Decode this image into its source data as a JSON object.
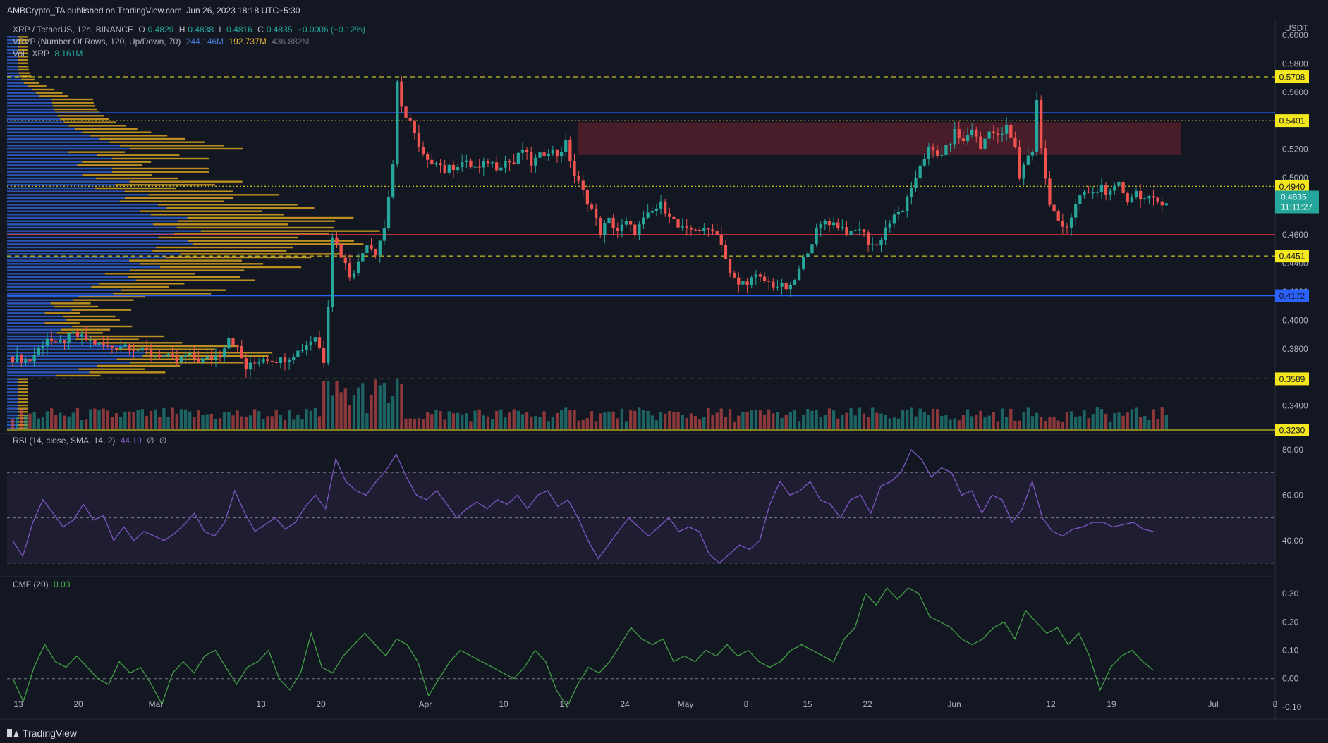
{
  "header": {
    "publisher": "AMBCrypto_TA published on TradingView.com, Jun 26, 2023 18:18 UTC+5:30"
  },
  "legend": {
    "symbol": "XRP / TetherUS, 12h, BINANCE",
    "o_label": "O",
    "o": "0.4829",
    "h_label": "H",
    "h": "0.4838",
    "l_label": "L",
    "l": "0.4816",
    "c_label": "C",
    "c": "0.4835",
    "change": "+0.0006 (+0.12%)",
    "vrvp_label": "VRVP (Number Of Rows, 120, Up/Down, 70)",
    "vrvp_up": "244.146M",
    "vrvp_down": "192.737M",
    "vrvp_total": "436.882M",
    "vol_label": "Vol · XRP",
    "vol_value": "8.161M",
    "rsi_label": "RSI (14, close, SMA, 14, 2)",
    "rsi_value": "44.19",
    "rsi_na1": "∅",
    "rsi_na2": "∅",
    "cmf_label": "CMF (20)",
    "cmf_value": "0.03"
  },
  "price_axis": {
    "currency": "USDT",
    "current_price": "0.4835",
    "countdown": "11:11:27"
  },
  "brand": "TradingView",
  "colors": {
    "background": "#131722",
    "up": "#26a69a",
    "down": "#ef5350",
    "level_yellow": "#f5e71e",
    "level_blue": "#2962ff",
    "level_red": "#f23645",
    "zone": "#5c1f2c",
    "vp_up": "#2f5fd0",
    "vp_down": "#d9a520",
    "rsi": "#7e57c2",
    "cmf": "#43a047"
  },
  "chart_data": [
    {
      "type": "candlestick",
      "title": "XRP / TetherUS, 12h, BINANCE",
      "ylim": [
        0.323,
        0.6
      ],
      "y_ticks": [
        "0.6000",
        "0.5800",
        "0.5600",
        "0.5200",
        "0.5000",
        "0.4600",
        "0.4400",
        "0.4200",
        "0.4000",
        "0.3800",
        "0.3600",
        "0.3400"
      ],
      "y_tick_values": [
        0.6,
        0.58,
        0.56,
        0.52,
        0.5,
        0.46,
        0.44,
        0.42,
        0.4,
        0.38,
        0.36,
        0.34
      ],
      "x_ticks": [
        "13",
        "20",
        "Mar",
        "13",
        "20",
        "Apr",
        "10",
        "17",
        "24",
        "May",
        "8",
        "15",
        "22",
        "Jun",
        "12",
        "19",
        "Jul",
        "8"
      ],
      "horizontal_levels": [
        {
          "label": "0.5708",
          "value": 0.5708,
          "style": "dashed",
          "color": "yellow"
        },
        {
          "label": "0.5401",
          "value": 0.5401,
          "style": "dotted",
          "color": "yellow"
        },
        {
          "label": "0.4940",
          "value": 0.494,
          "style": "dotted",
          "color": "yellow"
        },
        {
          "label": "0.4451",
          "value": 0.4451,
          "style": "dashed",
          "color": "yellow"
        },
        {
          "label": "0.4172",
          "value": 0.4172,
          "style": "solid",
          "color": "blue"
        },
        {
          "label": "0.3589",
          "value": 0.3589,
          "style": "dashed",
          "color": "yellow"
        },
        {
          "label": "0.3230",
          "value": 0.323,
          "style": "solid",
          "color": "yellow"
        },
        {
          "value": 0.5455,
          "style": "solid",
          "color": "blue"
        },
        {
          "value": 0.46,
          "style": "solid",
          "color": "red"
        }
      ],
      "supply_zone": {
        "low": 0.516,
        "high": 0.539
      },
      "current_price": 0.4835,
      "price_path": [
        [
          0,
          0.374
        ],
        [
          4,
          0.372
        ],
        [
          8,
          0.388
        ],
        [
          10,
          0.382
        ],
        [
          14,
          0.39
        ],
        [
          18,
          0.385
        ],
        [
          22,
          0.381
        ],
        [
          26,
          0.383
        ],
        [
          30,
          0.378
        ],
        [
          34,
          0.376
        ],
        [
          38,
          0.371
        ],
        [
          40,
          0.375
        ],
        [
          44,
          0.372
        ],
        [
          48,
          0.376
        ],
        [
          50,
          0.389
        ],
        [
          52,
          0.38
        ],
        [
          54,
          0.366
        ],
        [
          56,
          0.37
        ],
        [
          58,
          0.374
        ],
        [
          62,
          0.372
        ],
        [
          66,
          0.378
        ],
        [
          68,
          0.383
        ],
        [
          70,
          0.389
        ],
        [
          72,
          0.372
        ],
        [
          73,
          0.412
        ],
        [
          74,
          0.46
        ],
        [
          76,
          0.446
        ],
        [
          78,
          0.432
        ],
        [
          80,
          0.44
        ],
        [
          82,
          0.455
        ],
        [
          84,
          0.448
        ],
        [
          86,
          0.465
        ],
        [
          88,
          0.51
        ],
        [
          89,
          0.565
        ],
        [
          90,
          0.548
        ],
        [
          92,
          0.54
        ],
        [
          94,
          0.52
        ],
        [
          96,
          0.51
        ],
        [
          98,
          0.513
        ],
        [
          100,
          0.505
        ],
        [
          104,
          0.511
        ],
        [
          108,
          0.506
        ],
        [
          110,
          0.512
        ],
        [
          112,
          0.508
        ],
        [
          114,
          0.512
        ],
        [
          116,
          0.51
        ],
        [
          118,
          0.52
        ],
        [
          120,
          0.51
        ],
        [
          124,
          0.52
        ],
        [
          126,
          0.516
        ],
        [
          128,
          0.524
        ],
        [
          130,
          0.502
        ],
        [
          132,
          0.49
        ],
        [
          134,
          0.478
        ],
        [
          136,
          0.462
        ],
        [
          138,
          0.47
        ],
        [
          140,
          0.463
        ],
        [
          142,
          0.468
        ],
        [
          144,
          0.462
        ],
        [
          146,
          0.47
        ],
        [
          148,
          0.476
        ],
        [
          150,
          0.481
        ],
        [
          152,
          0.475
        ],
        [
          154,
          0.465
        ],
        [
          156,
          0.462
        ],
        [
          158,
          0.465
        ],
        [
          160,
          0.462
        ],
        [
          162,
          0.465
        ],
        [
          164,
          0.455
        ],
        [
          166,
          0.432
        ],
        [
          168,
          0.425
        ],
        [
          172,
          0.43
        ],
        [
          176,
          0.425
        ],
        [
          180,
          0.422
        ],
        [
          182,
          0.435
        ],
        [
          184,
          0.45
        ],
        [
          186,
          0.462
        ],
        [
          188,
          0.47
        ],
        [
          190,
          0.468
        ],
        [
          192,
          0.465
        ],
        [
          194,
          0.46
        ],
        [
          196,
          0.465
        ],
        [
          198,
          0.455
        ],
        [
          200,
          0.452
        ],
        [
          202,
          0.465
        ],
        [
          204,
          0.472
        ],
        [
          206,
          0.478
        ],
        [
          208,
          0.49
        ],
        [
          210,
          0.51
        ],
        [
          212,
          0.52
        ],
        [
          214,
          0.515
        ],
        [
          216,
          0.52
        ],
        [
          218,
          0.532
        ],
        [
          220,
          0.525
        ],
        [
          222,
          0.535
        ],
        [
          224,
          0.52
        ],
        [
          226,
          0.535
        ],
        [
          228,
          0.528
        ],
        [
          230,
          0.535
        ],
        [
          232,
          0.52
        ],
        [
          233,
          0.5
        ],
        [
          234,
          0.51
        ],
        [
          236,
          0.52
        ],
        [
          237,
          0.555
        ],
        [
          238,
          0.52
        ],
        [
          240,
          0.48
        ],
        [
          242,
          0.47
        ],
        [
          244,
          0.466
        ],
        [
          246,
          0.48
        ],
        [
          248,
          0.49
        ],
        [
          250,
          0.488
        ],
        [
          252,
          0.494
        ],
        [
          254,
          0.488
        ],
        [
          256,
          0.495
        ],
        [
          258,
          0.485
        ],
        [
          260,
          0.49
        ],
        [
          262,
          0.485
        ],
        [
          264,
          0.4835
        ]
      ],
      "volume_label": "Vol · XRP",
      "volume_last": "8.161M",
      "volume_profile": {
        "label": "VRVP (Number Of Rows, 120, Up/Down, 70)",
        "up": "244.146M",
        "down": "192.737M",
        "total": "436.882M",
        "poc": 0.4605
      }
    },
    {
      "type": "line",
      "title": "RSI (14, close, SMA, 14, 2)",
      "ylim": [
        25,
        85
      ],
      "y_ticks": [
        "80.00",
        "60.00",
        "40.00"
      ],
      "y_tick_values": [
        80,
        60,
        40
      ],
      "bands": [
        70,
        50,
        30
      ],
      "last_value": 44.19,
      "series": [
        {
          "values": [
            40,
            33,
            48,
            58,
            52,
            46,
            49,
            56,
            49,
            51,
            40,
            46,
            40,
            44,
            42,
            40,
            43,
            47,
            52,
            44,
            42,
            48,
            62,
            52,
            44,
            47,
            50,
            45,
            48,
            55,
            60,
            54,
            76,
            66,
            62,
            60,
            66,
            71,
            78,
            68,
            60,
            58,
            62,
            56,
            50,
            54,
            57,
            54,
            58,
            56,
            60,
            54,
            60,
            62,
            55,
            58,
            50,
            40,
            32,
            38,
            44,
            50,
            46,
            42,
            46,
            50,
            44,
            46,
            44,
            34,
            30,
            34,
            38,
            36,
            40,
            56,
            66,
            60,
            62,
            66,
            58,
            56,
            50,
            58,
            60,
            52,
            64,
            66,
            70,
            80,
            76,
            68,
            72,
            70,
            60,
            62,
            52,
            60,
            58,
            48,
            54,
            66,
            50,
            44,
            42,
            45,
            46,
            48,
            48,
            46,
            47,
            48,
            45,
            44
          ]
        }
      ]
    },
    {
      "type": "line",
      "title": "CMF (20)",
      "ylim": [
        -0.13,
        0.34
      ],
      "y_ticks": [
        "0.30",
        "0.20",
        "0.10",
        "0.00",
        "-0.10"
      ],
      "y_tick_values": [
        0.3,
        0.2,
        0.1,
        0.0,
        -0.1
      ],
      "last_value": 0.03,
      "series": [
        {
          "values": [
            0.0,
            -0.08,
            0.04,
            0.12,
            0.06,
            0.04,
            0.08,
            0.04,
            0.0,
            -0.02,
            0.06,
            0.02,
            0.04,
            -0.02,
            -0.09,
            0.02,
            0.06,
            0.02,
            0.08,
            0.1,
            0.04,
            -0.02,
            0.04,
            0.06,
            0.1,
            0.0,
            -0.04,
            0.02,
            0.16,
            0.04,
            0.02,
            0.08,
            0.12,
            0.16,
            0.12,
            0.08,
            0.14,
            0.12,
            0.06,
            -0.06,
            0.0,
            0.06,
            0.1,
            0.08,
            0.06,
            0.04,
            0.02,
            0.0,
            0.04,
            0.1,
            0.06,
            -0.04,
            -0.1,
            -0.02,
            0.04,
            0.02,
            0.06,
            0.12,
            0.18,
            0.14,
            0.12,
            0.14,
            0.06,
            0.08,
            0.06,
            0.1,
            0.08,
            0.12,
            0.08,
            0.1,
            0.06,
            0.04,
            0.06,
            0.1,
            0.12,
            0.1,
            0.08,
            0.06,
            0.14,
            0.18,
            0.3,
            0.26,
            0.32,
            0.28,
            0.32,
            0.3,
            0.22,
            0.2,
            0.18,
            0.14,
            0.12,
            0.14,
            0.18,
            0.2,
            0.14,
            0.24,
            0.2,
            0.16,
            0.18,
            0.12,
            0.16,
            0.08,
            -0.04,
            0.04,
            0.08,
            0.1,
            0.06,
            0.03
          ]
        }
      ]
    }
  ]
}
